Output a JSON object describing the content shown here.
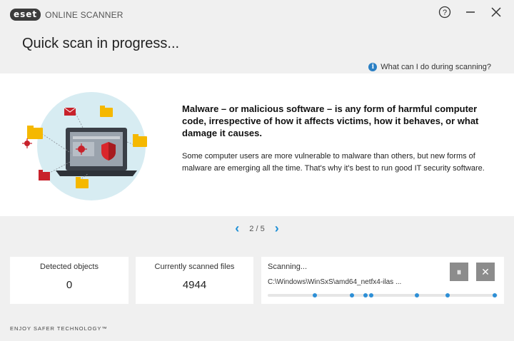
{
  "window": {
    "logo_badge": "eset",
    "logo_text": "ONLINE SCANNER",
    "help_symbol": "?",
    "minimize_symbol": "—",
    "close_symbol": "✕"
  },
  "page": {
    "title": "Quick scan in progress...",
    "help_link": "What can I do during scanning?",
    "info_symbol": "i"
  },
  "tip": {
    "headline": "Malware – or malicious software – is any form of harmful computer code, irrespective of how it affects victims, how it behaves, or what damage it causes.",
    "body": "Some computer users are more vulnerable to malware than others, but new forms of malware are emerging all the time. That's why it's best to run good IT security software."
  },
  "pager": {
    "prev": "‹",
    "next": "›",
    "count": "2 / 5"
  },
  "stats": {
    "detected_label": "Detected objects",
    "detected_value": "0",
    "scanned_label": "Currently scanned files",
    "scanned_value": "4944",
    "scanning_label": "Scanning...",
    "scanning_path": "C:\\Windows\\WinSxS\\amd64_netfx4-ilas ...",
    "pause_symbol": "⏸",
    "stop_symbol": "✕"
  },
  "footer": {
    "text": "ENJOY SAFER TECHNOLOGY™"
  },
  "colors": {
    "accent": "#1d8fd6",
    "background": "#f0f0f0",
    "panel": "#ffffff",
    "control_button": "#8c8c8c"
  }
}
